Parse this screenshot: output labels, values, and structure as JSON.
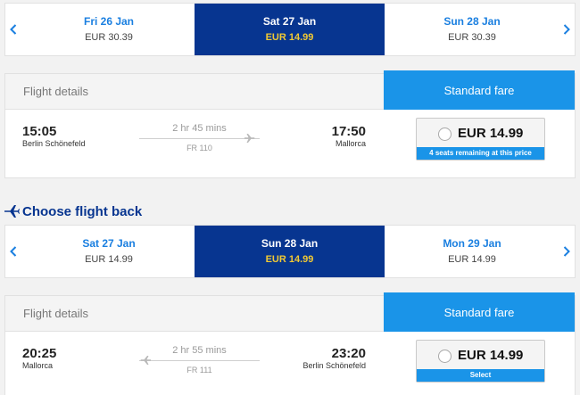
{
  "outbound": {
    "dates": [
      {
        "day": "Fri 26 Jan",
        "price": "EUR 30.39"
      },
      {
        "day": "Sat 27 Jan",
        "price": "EUR 14.99"
      },
      {
        "day": "Sun 28 Jan",
        "price": "EUR 30.39"
      }
    ],
    "card": {
      "details_label": "Flight details",
      "fare_label": "Standard fare",
      "depart_time": "15:05",
      "depart_place": "Berlin Schönefeld",
      "duration": "2 hr 45 mins",
      "flight_number": "FR 110",
      "arrive_time": "17:50",
      "arrive_place": "Mallorca",
      "price": "EUR 14.99",
      "price_note": "4 seats remaining at this price"
    }
  },
  "return_title": "Choose flight back",
  "inbound": {
    "dates": [
      {
        "day": "Sat 27 Jan",
        "price": "EUR 14.99"
      },
      {
        "day": "Sun 28 Jan",
        "price": "EUR 14.99"
      },
      {
        "day": "Mon 29 Jan",
        "price": "EUR 14.99"
      }
    ],
    "card": {
      "details_label": "Flight details",
      "fare_label": "Standard fare",
      "depart_time": "20:25",
      "depart_place": "Mallorca",
      "duration": "2 hr 55 mins",
      "flight_number": "FR 111",
      "arrive_time": "23:20",
      "arrive_place": "Berlin Schönefeld",
      "price": "EUR 14.99",
      "price_note": "Select"
    }
  },
  "colors": {
    "active_date_bg": "#073590",
    "active_price": "#f1c933",
    "accent": "#1a94e8",
    "date_link": "#1a7fe0"
  }
}
